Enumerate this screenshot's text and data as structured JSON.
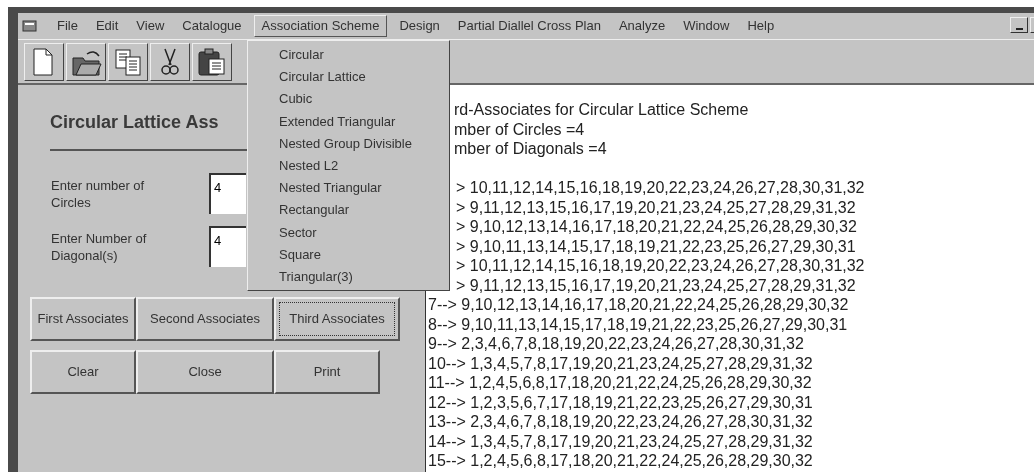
{
  "menu_bar": {
    "items": [
      {
        "label": "File",
        "selected": false
      },
      {
        "label": "Edit",
        "selected": false
      },
      {
        "label": "View",
        "selected": false
      },
      {
        "label": "Catalogue",
        "selected": false
      },
      {
        "label": "Association Scheme",
        "selected": true
      },
      {
        "label": "Design",
        "selected": false
      },
      {
        "label": "Partial Diallel Cross Plan",
        "selected": false
      },
      {
        "label": "Analyze",
        "selected": false
      },
      {
        "label": "Window",
        "selected": false
      },
      {
        "label": "Help",
        "selected": false
      }
    ]
  },
  "dropdown": {
    "open": true,
    "items": [
      "Circular",
      "Circular Lattice",
      "Cubic",
      "Extended Triangular",
      "Nested Group Divisible",
      "Nested L2",
      "Nested Triangular",
      "Rectangular",
      "Sector",
      "Square",
      "Triangular(3)"
    ]
  },
  "toolbar": {
    "buttons": [
      {
        "kind": "new"
      },
      {
        "kind": "open"
      },
      {
        "kind": "copy"
      },
      {
        "kind": "cut"
      },
      {
        "kind": "paste"
      }
    ]
  },
  "form": {
    "title": "Circular Lattice Ass",
    "fields": [
      {
        "label": "Enter number of Circles",
        "value": "4"
      },
      {
        "label": "Enter Number of Diagonal(s)",
        "value": "4"
      }
    ],
    "associate_buttons": [
      {
        "label": "First Associates",
        "focused": false
      },
      {
        "label": "Second Associates",
        "focused": false
      },
      {
        "label": "Third Associates",
        "focused": true
      }
    ],
    "action_buttons": [
      "Clear",
      "Close",
      "Print"
    ]
  },
  "output": {
    "header": [
      "rd-Associates for Circular Lattice Scheme",
      "mber of Circles =4",
      "mber of Diagonals =4"
    ],
    "rows": [
      {
        "kind": "cut",
        "text": "> 10,11,12,14,15,16,18,19,20,22,23,24,26,27,28,30,31,32"
      },
      {
        "kind": "cut",
        "text": "> 9,11,12,13,15,16,17,19,20,21,23,24,25,27,28,29,31,32"
      },
      {
        "kind": "cut",
        "text": "> 9,10,12,13,14,16,17,18,20,21,22,24,25,26,28,29,30,32"
      },
      {
        "kind": "cut",
        "text": "> 9,10,11,13,14,15,17,18,19,21,22,23,25,26,27,29,30,31"
      },
      {
        "kind": "cut",
        "text": "> 10,11,12,14,15,16,18,19,20,22,23,24,26,27,28,30,31,32"
      },
      {
        "kind": "cut",
        "text": "> 9,11,12,13,15,16,17,19,20,21,23,24,25,27,28,29,31,32"
      },
      {
        "kind": "full",
        "text": "7--> 9,10,12,13,14,16,17,18,20,21,22,24,25,26,28,29,30,32"
      },
      {
        "kind": "full",
        "text": "8--> 9,10,11,13,14,15,17,18,19,21,22,23,25,26,27,29,30,31"
      },
      {
        "kind": "full",
        "text": "9--> 2,3,4,6,7,8,18,19,20,22,23,24,26,27,28,30,31,32"
      },
      {
        "kind": "full",
        "text": "10--> 1,3,4,5,7,8,17,19,20,21,23,24,25,27,28,29,31,32"
      },
      {
        "kind": "full",
        "text": "11--> 1,2,4,5,6,8,17,18,20,21,22,24,25,26,28,29,30,32"
      },
      {
        "kind": "full",
        "text": "12--> 1,2,3,5,6,7,17,18,19,21,22,23,25,26,27,29,30,31"
      },
      {
        "kind": "full",
        "text": "13--> 2,3,4,6,7,8,18,19,20,22,23,24,26,27,28,30,31,32"
      },
      {
        "kind": "full",
        "text": "14--> 1,3,4,5,7,8,17,19,20,21,23,24,25,27,28,29,31,32"
      },
      {
        "kind": "full",
        "text": "15--> 1,2,4,5,6,8,17,18,20,21,22,24,25,26,28,29,30,32"
      }
    ]
  }
}
